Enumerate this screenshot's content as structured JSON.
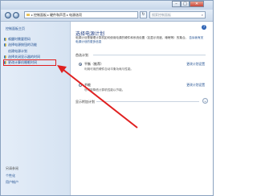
{
  "window": {
    "title": "",
    "controls": {
      "minimize": "–",
      "maximize": "□",
      "close": "✕"
    }
  },
  "navbar": {
    "back": "‹",
    "forward": "›",
    "address": [
      "控制面板",
      "硬件和声音",
      "电源选项"
    ],
    "refresh": "↻",
    "search_placeholder": "搜索控制面板"
  },
  "sidebar": {
    "items": [
      {
        "label": "控制面板主页"
      },
      {
        "label": "唤醒时需要密码"
      },
      {
        "label": "选择电源按钮的功能"
      },
      {
        "label": "创建电源计划"
      },
      {
        "label": "选择关闭显示器的时间"
      },
      {
        "label": "更改计算机睡眠时间"
      }
    ],
    "see_also_label": "另请参阅",
    "see_also": [
      {
        "label": "个性化"
      },
      {
        "label": "用户帐户"
      }
    ]
  },
  "main": {
    "help_icon": "?",
    "title": "选择电源计划",
    "description": "电源计划是管理计算机如何使用电源的硬件和系统设置（如显示亮度、睡眠等）的集合。",
    "description_link": "告诉我有关电源计划的更多信息",
    "preferred_label": "首选计划",
    "plans": [
      {
        "name": "平衡（推荐）",
        "desc": "利用可用的硬件自动平衡功耗与性能。",
        "link": "更改计划设置",
        "selected": true
      },
      {
        "name": "节能",
        "desc": "尽可能降低计算机性能以节能。",
        "link": "更改计划设置",
        "selected": false
      }
    ],
    "additional_label": "显示附加计划",
    "expand_icon": "⌄"
  },
  "colors": {
    "arrow": "#e02020",
    "highlight": "#e02020",
    "link": "#1b4b8e"
  }
}
